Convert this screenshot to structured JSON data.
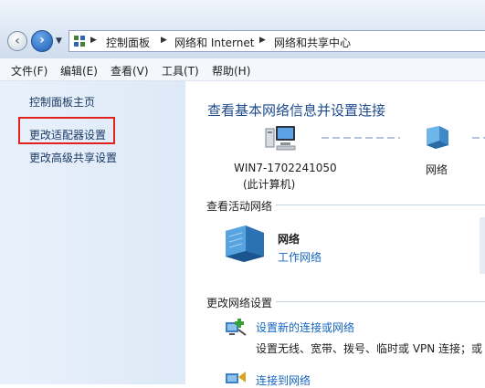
{
  "address": {
    "crumbs": [
      "控制面板",
      "网络和 Internet",
      "网络和共享中心"
    ]
  },
  "menu": [
    "文件(F)",
    "编辑(E)",
    "查看(V)",
    "工具(T)",
    "帮助(H)"
  ],
  "sidebar": {
    "items": [
      {
        "label": "控制面板主页"
      },
      {
        "label": "更改适配器设置"
      },
      {
        "label": "更改高级共享设置"
      }
    ]
  },
  "main": {
    "title": "查看基本网络信息并设置连接",
    "computer": {
      "name": "WIN7-1702241050",
      "note": "(此计算机)"
    },
    "network_node": "网络",
    "active_header": "查看活动网络",
    "active_network": {
      "name": "网络",
      "type": "工作网络"
    },
    "change_header": "更改网络设置",
    "tasks": [
      {
        "label": "设置新的连接或网络",
        "desc": "设置无线、宽带、拨号、临时或 VPN 连接；或"
      },
      {
        "label": "连接到网络"
      }
    ]
  },
  "colors": {
    "accent": "#1f4b8f",
    "link": "#1565c0",
    "highlight": "#e0211c"
  }
}
